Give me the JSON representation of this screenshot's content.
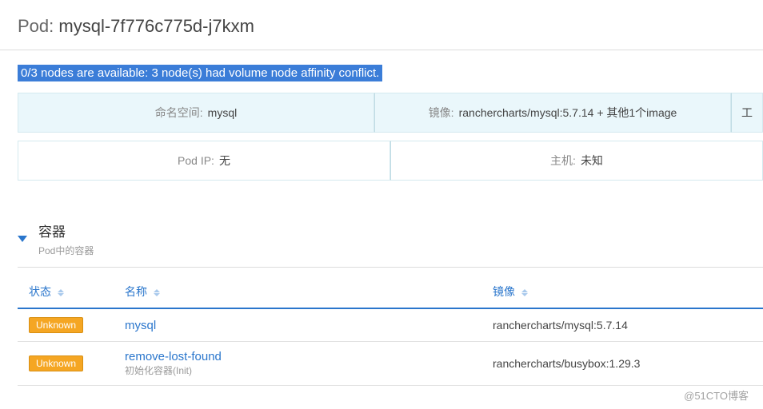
{
  "title": {
    "label": "Pod:",
    "name": "mysql-7f776c775d-j7kxm"
  },
  "error": "0/3 nodes are available: 3 node(s) had volume node affinity conflict.",
  "cards1": [
    {
      "label": "命名空间:",
      "value": "mysql"
    },
    {
      "label": "镜像:",
      "value": "ranchercharts/mysql:5.7.14 + 其他1个image"
    },
    {
      "label": "",
      "value": "工"
    }
  ],
  "cards2": [
    {
      "label": "Pod IP:",
      "value": "无"
    },
    {
      "label": "主机:",
      "value": "未知"
    }
  ],
  "section": {
    "title": "容器",
    "subtitle": "Pod中的容器"
  },
  "columns": {
    "status": "状态",
    "name": "名称",
    "image": "镜像"
  },
  "rows": [
    {
      "status": "Unknown",
      "name": "mysql",
      "sub": "",
      "image": "ranchercharts/mysql:5.7.14"
    },
    {
      "status": "Unknown",
      "name": "remove-lost-found",
      "sub": "初始化容器(Init)",
      "image": "ranchercharts/busybox:1.29.3"
    }
  ],
  "watermark": "@51CTO博客"
}
